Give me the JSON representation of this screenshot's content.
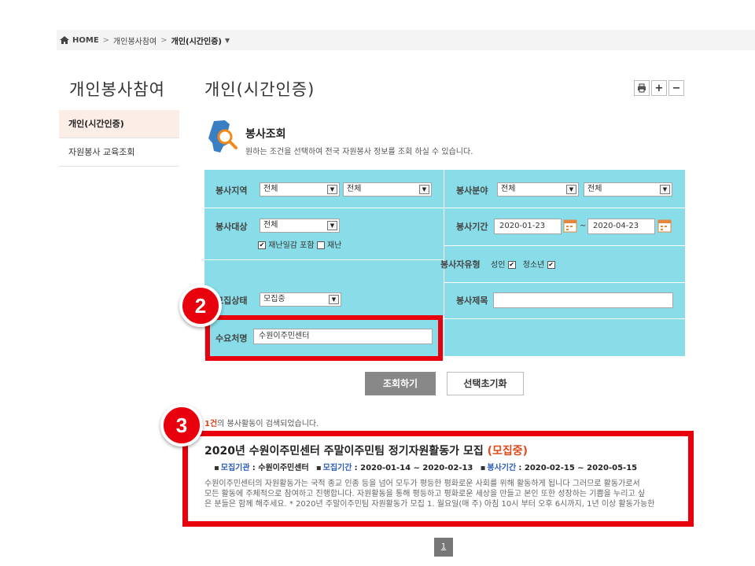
{
  "breadcrumb": {
    "home": "HOME",
    "level1": "개인봉사참여",
    "current": "개인(시간인증)"
  },
  "sidebar": {
    "title": "개인봉사참여",
    "items": [
      {
        "label": "개인(시간인증)",
        "active": true
      },
      {
        "label": "자원봉사 교육조회",
        "active": false
      }
    ]
  },
  "page": {
    "title": "개인(시간인증)"
  },
  "search": {
    "heading": "봉사조회",
    "description": "원하는 조건을 선택하여 전국 자원봉사 정보를 조회 하실 수 있습니다."
  },
  "form": {
    "region_label": "봉사지역",
    "region_value1": "전체",
    "region_value2": "전체",
    "field_label": "봉사분야",
    "field_value1": "전체",
    "field_value2": "전체",
    "target_label": "봉사대상",
    "target_value": "전체",
    "disaster_incl_label": "재난일감 포함",
    "disaster_incl_checked": true,
    "disaster_label": "재난",
    "disaster_checked": false,
    "period_label": "봉사기간",
    "period_start": "2020-01-23",
    "period_sep": "~",
    "period_end": "2020-04-23",
    "volunteer_type_label": "봉사자유형",
    "adult_label": "성인",
    "adult_checked": true,
    "youth_label": "청소년",
    "youth_checked": true,
    "status_label": "모집상태",
    "status_value": "모집중",
    "title_label": "봉사제목",
    "title_value": "",
    "org_label": "수요처명",
    "org_value": "수원이주민센터"
  },
  "buttons": {
    "search": "조회하기",
    "reset": "선택초기화"
  },
  "result": {
    "count_num": "1건",
    "count_text": "의 봉사활동이 검색되었습니다."
  },
  "card": {
    "title": "2020년 수원이주민센터 주말이주민팀 정기자원활동가 모집",
    "status": "(모집중)",
    "org_label": "모집기관",
    "org_value": ": 수원이주민센터",
    "recruit_label": "모집기간",
    "recruit_value": ": 2020-01-14 ~ 2020-02-13",
    "service_label": "봉사기간",
    "service_value": ": 2020-02-15 ~ 2020-05-15",
    "body_line1": "수원이주민센터의 자원활동가는 국적 종교 인종 등을 넘어 모두가 평등한 평화로운 사회를 위해 활동하게 됩니다 그러므로 활동가로서",
    "body_line2": "모든 활동에 주체적으로 참여하고 진행합니다. 자원활동을 통해 평등하고 평화로운 세상을 만들고 본인 또한 성장하는 기쁨을 누리고 싶",
    "body_line3": "은 분들은 함께 해주세요. * 2020년 주말이주민팀 자원활동가 모집 1. 월요일(매 주) 아침 10시 부터 오후 6시까지, 1년 이상 활동가능한"
  },
  "pagination": {
    "page": "1"
  },
  "annotations": {
    "badge2": "2",
    "badge3": "3"
  },
  "colors": {
    "form_bg": "#88dde8",
    "annotation_red": "#e8000c",
    "status_orange": "#e04a1c",
    "meta_blue": "#2a5cb8"
  }
}
